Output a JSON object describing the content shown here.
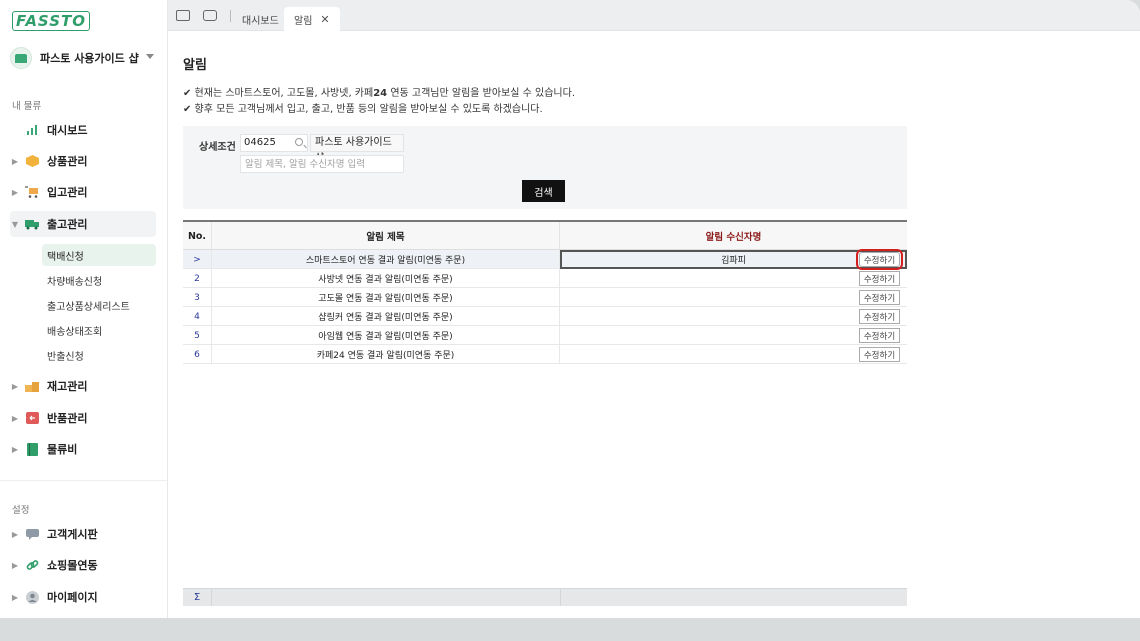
{
  "brand": {
    "logo_text": "FASSTO"
  },
  "sidebar": {
    "shop_name": "파스토 사용가이드 샵",
    "section_main": "내 물류",
    "items": [
      {
        "label": "대시보드",
        "icon": "bar-chart-icon"
      },
      {
        "label": "상품관리",
        "icon": "box-icon"
      },
      {
        "label": "입고관리",
        "icon": "cart-icon"
      },
      {
        "label": "출고관리",
        "icon": "truck-icon"
      },
      {
        "label": "재고관리",
        "icon": "boxes-icon"
      },
      {
        "label": "반품관리",
        "icon": "return-icon"
      },
      {
        "label": "물류비",
        "icon": "book-icon"
      }
    ],
    "sub_items": [
      "택배신청",
      "차량배송신청",
      "출고상품상세리스트",
      "배송상태조회",
      "반출신청"
    ],
    "section_settings": "설정",
    "settings_items": [
      {
        "label": "고객게시판",
        "icon": "chat-icon"
      },
      {
        "label": "쇼핑몰연동",
        "icon": "link-icon"
      },
      {
        "label": "마이페이지",
        "icon": "user-icon"
      }
    ]
  },
  "tabs": [
    {
      "label": "대시보드"
    },
    {
      "label": "알림"
    }
  ],
  "page": {
    "title": "알림",
    "notice1_pre": "✔ 현재는 스마트스토어, 고도몰, 사방넷, 카페",
    "notice1_bold": "24",
    "notice1_post": " 연동 고객님만 알림을 받아보실 수 있습니다.",
    "notice2": "✔ 향후 모든 고객님께서 입고, 출고, 반품 등의 알림을 받아보실 수 있도록 하겠습니다."
  },
  "search": {
    "label": "상세조건",
    "code": "04625",
    "shop": "파스토 사용가이드 샵",
    "placeholder": "알림 제목, 알림 수신자명 입력",
    "button": "검색"
  },
  "table": {
    "headers": {
      "no": "No.",
      "title": "알림 제목",
      "recipient": "알림 수신자명"
    },
    "edit_label": "수정하기",
    "rows": [
      {
        "no": ">",
        "title": "스마트스토어 연동 결과 알림(미연동 주문)",
        "recipient": "김파피"
      },
      {
        "no": "2",
        "title": "사방넷 연동 결과 알림(미연동 주문)",
        "recipient": ""
      },
      {
        "no": "3",
        "title": "고도몰 연동 결과 알림(미연동 주문)",
        "recipient": ""
      },
      {
        "no": "4",
        "title": "샵링커 연동 결과 알림(미연동 주문)",
        "recipient": ""
      },
      {
        "no": "5",
        "title": "아임웹 연동 결과 알림(미연동 주문)",
        "recipient": ""
      },
      {
        "no": "6",
        "title": "카페24 연동 결과 알림(미연동 주문)",
        "recipient": ""
      }
    ],
    "footer_symbol": "Σ"
  },
  "colors": {
    "brand": "#2f9e6a",
    "highlight": "#d41f1f",
    "header_red": "#8b1a1a"
  }
}
